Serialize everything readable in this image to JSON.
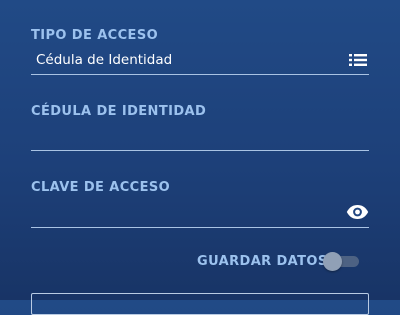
{
  "form": {
    "access_type": {
      "label": "TIPO DE ACCESO",
      "value": "Cédula de Identidad",
      "icon": "list-icon"
    },
    "id_number": {
      "label": "CÉDULA DE IDENTIDAD",
      "value": ""
    },
    "password": {
      "label": "CLAVE DE ACCESO",
      "value": "",
      "icon": "eye-icon"
    },
    "save_data": {
      "label": "GUARDAR DATOS",
      "enabled": false
    }
  },
  "colors": {
    "label": "#9cc2ee",
    "text": "#ffffff",
    "underline": "#a9c3e4",
    "background_top": "#214a86",
    "background_bottom": "#183466"
  }
}
